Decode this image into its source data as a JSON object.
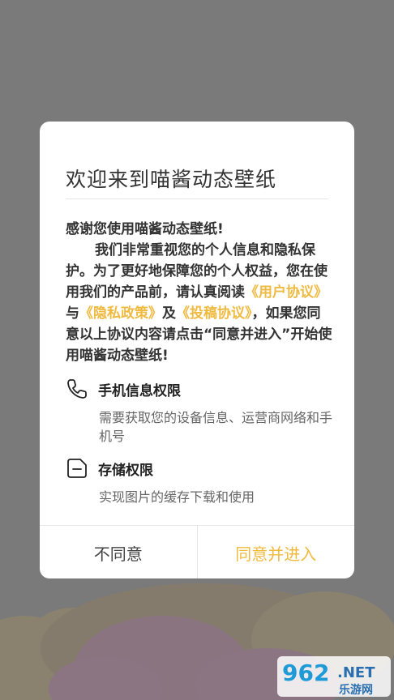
{
  "dialog": {
    "title": "欢迎来到喵酱动态壁纸",
    "intro": {
      "greeting": "感谢您使用喵酱动态壁纸!",
      "text_1": "我们非常重视您的个人信息和隐私保护。为了更好地保障您的个人权益，您在使用我们的产品前，请认真阅读",
      "link_user_agreement": "《用户协议》",
      "text_2": "与",
      "link_privacy_policy": "《隐私政策》",
      "text_3": "及",
      "link_submission_agreement": "《投稿协议》",
      "text_4": "，如果您同意以上协议内容请点击“同意并进入”开始使用喵酱动态壁纸!"
    },
    "permissions": [
      {
        "icon": "phone-icon",
        "title": "手机信息权限",
        "description": "需要获取您的设备信息、运营商网络和手机号"
      },
      {
        "icon": "storage-icon",
        "title": "存储权限",
        "description": "实现图片的缓存下载和使用"
      }
    ],
    "buttons": {
      "disagree": "不同意",
      "agree": "同意并进入"
    }
  },
  "watermark": {
    "brand_number": "962",
    "brand_suffix": ".NET",
    "brand_subtitle": "乐游网"
  },
  "colors": {
    "accent": "#f0ba40",
    "overlay": "#7a7a7a",
    "text_primary": "#333333",
    "text_secondary": "#666666"
  }
}
